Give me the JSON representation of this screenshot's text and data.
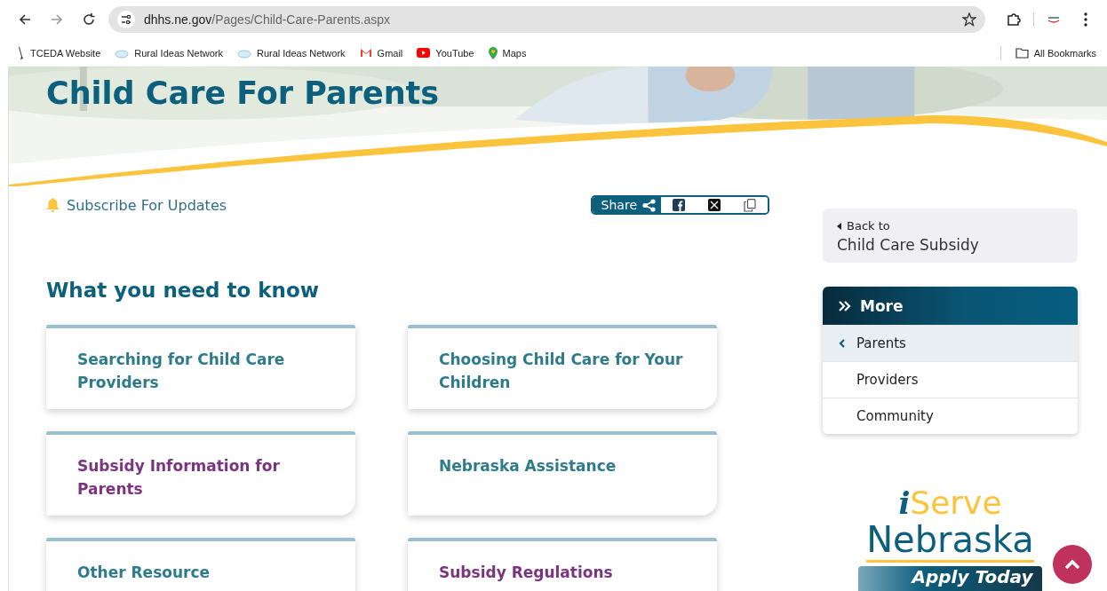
{
  "browser": {
    "url_host": "dhhs.ne.gov",
    "url_path": "/Pages/Child-Care-Parents.aspx",
    "bookmarks": [
      {
        "label": "TCEDA Website",
        "kind": "pen"
      },
      {
        "label": "Rural Ideas Network",
        "kind": "cloud"
      },
      {
        "label": "Rural Ideas Network",
        "kind": "cloud"
      },
      {
        "label": "Gmail",
        "kind": "gmail"
      },
      {
        "label": "YouTube",
        "kind": "youtube"
      },
      {
        "label": "Maps",
        "kind": "maps"
      }
    ],
    "all_bookmarks": "All Bookmarks"
  },
  "page": {
    "title": "Child Care For Parents",
    "subscribe": "Subscribe For Updates",
    "share": "Share",
    "section_heading": "What you need to know",
    "cards": [
      {
        "title": "Searching for Child Care Providers",
        "color": "#2e7b8c"
      },
      {
        "title": "Choosing Child Care for Your Children",
        "color": "#2e7b8c"
      },
      {
        "title": "Subsidy Information for Parents",
        "color": "#7b3580"
      },
      {
        "title": "Nebraska Assistance",
        "color": "#2e7b8c"
      },
      {
        "title": "Other Resource",
        "color": "#2e7b8c"
      },
      {
        "title": "Subsidy Regulations",
        "color": "#7b3580"
      }
    ],
    "back": {
      "label": "Back to",
      "target": "Child Care Subsidy"
    },
    "more": {
      "title": "More",
      "items": [
        {
          "label": "Parents",
          "selected": true
        },
        {
          "label": "Providers",
          "selected": false
        },
        {
          "label": "Community",
          "selected": false
        }
      ]
    },
    "logo": {
      "i": "i",
      "serve": "Serve",
      "name": "Nebraska",
      "tagline": "Apply Today"
    }
  }
}
